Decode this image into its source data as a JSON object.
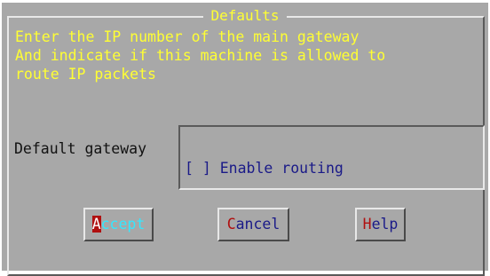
{
  "dialog": {
    "title": "Defaults",
    "description": "Enter the IP number of the main gateway\nAnd indicate if this machine is allowed to\nroute IP packets"
  },
  "gateway": {
    "label": "Default gateway",
    "value": ""
  },
  "routing": {
    "checkbox": "[ ]",
    "label": "Enable routing",
    "checked": false
  },
  "buttons": {
    "accept": {
      "hotkey": "A",
      "rest": "ccept"
    },
    "cancel": {
      "hotkey": "C",
      "rest": "ancel"
    },
    "help": {
      "hotkey": "H",
      "rest": "elp"
    }
  },
  "colors": {
    "dialog_bg": "#a8a8a8",
    "title_text": "#ffff33",
    "hotkey": "#b01010",
    "button_text": "#1a1a88",
    "focused_button_text": "#33e8ff"
  }
}
